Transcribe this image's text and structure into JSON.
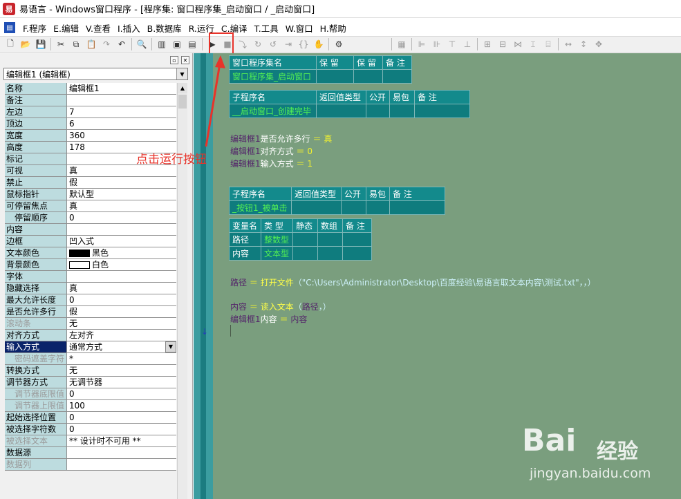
{
  "window": {
    "title": "易语言 - Windows窗口程序 - [程序集: 窗口程序集_启动窗口 / _启动窗口]",
    "logo_text": "易"
  },
  "menu": [
    {
      "label": "F.程序"
    },
    {
      "label": "E.编辑"
    },
    {
      "label": "V.查看"
    },
    {
      "label": "I.插入"
    },
    {
      "label": "B.数据库"
    },
    {
      "label": "R.运行"
    },
    {
      "label": "C.编译"
    },
    {
      "label": "T.工具"
    },
    {
      "label": "W.窗口"
    },
    {
      "label": "H.帮助"
    }
  ],
  "toolbar": {
    "run_glyph": "▶",
    "stop_glyph": "■"
  },
  "left_panel": {
    "combo_value": "编辑框1 (编辑框)",
    "props": [
      {
        "name": "名称",
        "value": "编辑框1"
      },
      {
        "name": "备注",
        "value": ""
      },
      {
        "name": "左边",
        "value": "7"
      },
      {
        "name": "顶边",
        "value": "6"
      },
      {
        "name": "宽度",
        "value": "360"
      },
      {
        "name": "高度",
        "value": "178"
      },
      {
        "name": "标记",
        "value": ""
      },
      {
        "name": "可视",
        "value": "真"
      },
      {
        "name": "禁止",
        "value": "假"
      },
      {
        "name": "鼠标指针",
        "value": "默认型"
      },
      {
        "name": "可停留焦点",
        "value": "真"
      },
      {
        "name": "停留顺序",
        "value": "0",
        "indent": true
      },
      {
        "name": "内容",
        "value": ""
      },
      {
        "name": "边框",
        "value": "凹入式"
      },
      {
        "name": "文本颜色",
        "value": "黑色",
        "swatch": "#000000"
      },
      {
        "name": "背景颜色",
        "value": "白色",
        "swatch": "#ffffff"
      },
      {
        "name": "字体",
        "value": ""
      },
      {
        "name": "隐藏选择",
        "value": "真"
      },
      {
        "name": "最大允许长度",
        "value": "0"
      },
      {
        "name": "是否允许多行",
        "value": "假"
      },
      {
        "name": "滚动条",
        "value": "无",
        "grey": true
      },
      {
        "name": "对齐方式",
        "value": "左对齐"
      },
      {
        "name": "输入方式",
        "value": "通常方式",
        "selected": true,
        "dropdown": true
      },
      {
        "name": "密码遮盖字符",
        "value": "*",
        "indent": true,
        "grey": true
      },
      {
        "name": "转换方式",
        "value": "无"
      },
      {
        "name": "调节器方式",
        "value": "无调节器"
      },
      {
        "name": "调节器底限值",
        "value": "0",
        "indent": true,
        "grey": true
      },
      {
        "name": "调节器上限值",
        "value": "100",
        "indent": true,
        "grey": true
      },
      {
        "name": "起始选择位置",
        "value": "0"
      },
      {
        "name": "被选择字符数",
        "value": "0"
      },
      {
        "name": "被选择文本",
        "value": "** 设计时不可用 **",
        "grey": true
      },
      {
        "name": "数据源",
        "value": ""
      },
      {
        "name": "数据列",
        "value": "",
        "grey": true
      }
    ]
  },
  "code": {
    "assembly_table": {
      "headers": [
        "窗口程序集名",
        "保 留",
        "保 留",
        "备 注"
      ],
      "row": [
        "窗口程序集_启动窗口",
        "",
        "",
        ""
      ]
    },
    "sub1_table": {
      "headers": [
        "子程序名",
        "返回值类型",
        "公开",
        "易包",
        "备 注"
      ],
      "row": [
        "__启动窗口_创建完毕",
        "",
        "",
        "",
        ""
      ]
    },
    "lines1": [
      {
        "obj": "编辑框1",
        "prop": "是否允许多行",
        "eq": "＝",
        "val": "真"
      },
      {
        "obj": "编辑框1",
        "prop": "对齐方式",
        "eq": "＝",
        "val": "0"
      },
      {
        "obj": "编辑框1",
        "prop": "输入方式",
        "eq": "＝",
        "val": "1"
      }
    ],
    "sub2_table": {
      "headers": [
        "子程序名",
        "返回值类型",
        "公开",
        "易包",
        "备 注"
      ],
      "row": [
        "_按钮1_被单击",
        "",
        "",
        "",
        ""
      ]
    },
    "var_table": {
      "headers": [
        "变量名",
        "类 型",
        "静态",
        "数组",
        "备 注"
      ],
      "rows": [
        [
          "路径",
          "整数型",
          "",
          "",
          ""
        ],
        [
          "内容",
          "文本型",
          "",
          "",
          ""
        ]
      ]
    },
    "line_open": {
      "var": "路径",
      "eq": "＝",
      "func": "打开文件",
      "open": "（",
      "arg": "\"C:\\Users\\Administrator\\Desktop\\百度经验\\易语言取文本内容\\测试.txt\"",
      "rest": "，，）"
    },
    "line_read": {
      "var": "内容",
      "eq": "＝",
      "func": "读入文本",
      "open": "（",
      "arg": "路径",
      "rest": "，）"
    },
    "line_assign": {
      "obj": "编辑框1",
      "prop": "内容",
      "eq": "＝",
      "val": "内容"
    }
  },
  "annotation": {
    "text": "点击运行按钮",
    "color": "#e8332a"
  },
  "watermark": {
    "brand_bai": "Bai",
    "brand_cn": "经验",
    "url": "jingyan.baidu.com"
  }
}
